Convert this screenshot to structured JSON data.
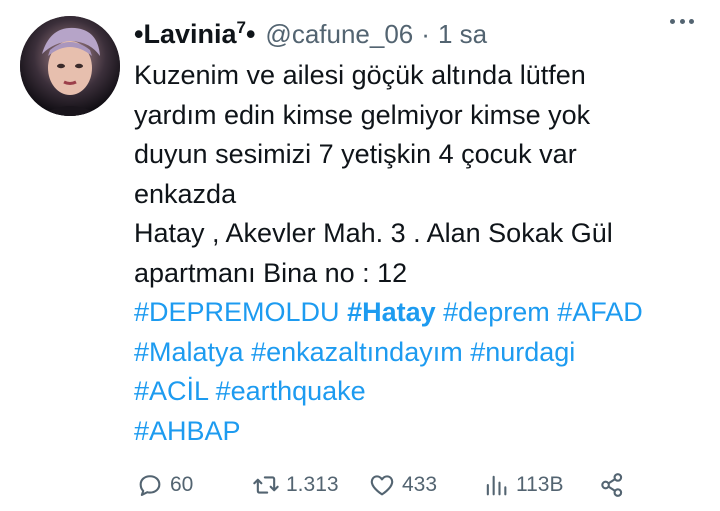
{
  "tweet": {
    "display_name": "•Lavinia",
    "display_name_sup": "7",
    "display_name_suffix": "•",
    "handle": "@cafune_06",
    "separator": "·",
    "time": "1 sa",
    "text_lines": [
      "Kuzenim ve ailesi göçük altında lütfen",
      "yardım edin kimse gelmiyor kimse yok",
      "duyun sesimizi 7 yetişkin 4 çocuk var",
      "enkazda",
      "Hatay , Akevler Mah.  3 . Alan Sokak Gül",
      "apartmanı Bina no : 12"
    ],
    "hashtags": [
      "#DEPREMOLDU",
      "#Hatay",
      "#deprem",
      "#AFAD",
      "#Malatya",
      "#enkazaltındayım",
      "#nurdagi",
      "#ACİL",
      "#earthquake",
      "#AHBAP"
    ]
  },
  "actions": {
    "replies": "60",
    "retweets": "1.313",
    "likes": "433",
    "views": "113B"
  },
  "colors": {
    "link": "#1d9bf0",
    "muted": "#536471",
    "text": "#0f1419"
  },
  "icons": [
    "more-icon",
    "reply-icon",
    "retweet-icon",
    "like-icon",
    "views-icon",
    "share-icon"
  ]
}
